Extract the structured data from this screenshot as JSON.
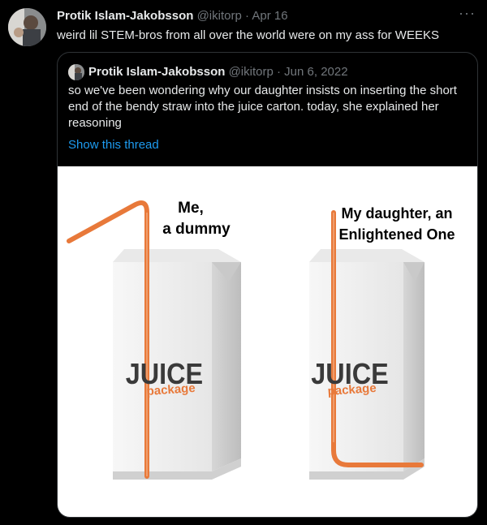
{
  "tweet": {
    "author_name": "Protik Islam-Jakobsson",
    "handle": "@ikitorp",
    "date": "Apr 16",
    "text": "weird lil STEM-bros from all over the world were on my ass for WEEKS",
    "more_icon": "more-horizontal-icon"
  },
  "quoted": {
    "author_name": "Protik Islam-Jakobsson",
    "handle": "@ikitorp",
    "date": "Jun 6, 2022",
    "text": "so we've been wondering why our daughter insists on inserting the short end of the bendy straw into the juice carton. today, she explained her reasoning",
    "thread_link": "Show this thread"
  },
  "image": {
    "left_caption_line1": "Me,",
    "left_caption_line2": "a dummy",
    "right_caption_line1": "My daughter, an",
    "right_caption_line2": "Enlightened One",
    "brand_big": "JUICE",
    "brand_small": "package"
  },
  "colors": {
    "background": "#000000",
    "link": "#1d9bf0",
    "muted": "#71767b",
    "straw": "#e8793a"
  }
}
